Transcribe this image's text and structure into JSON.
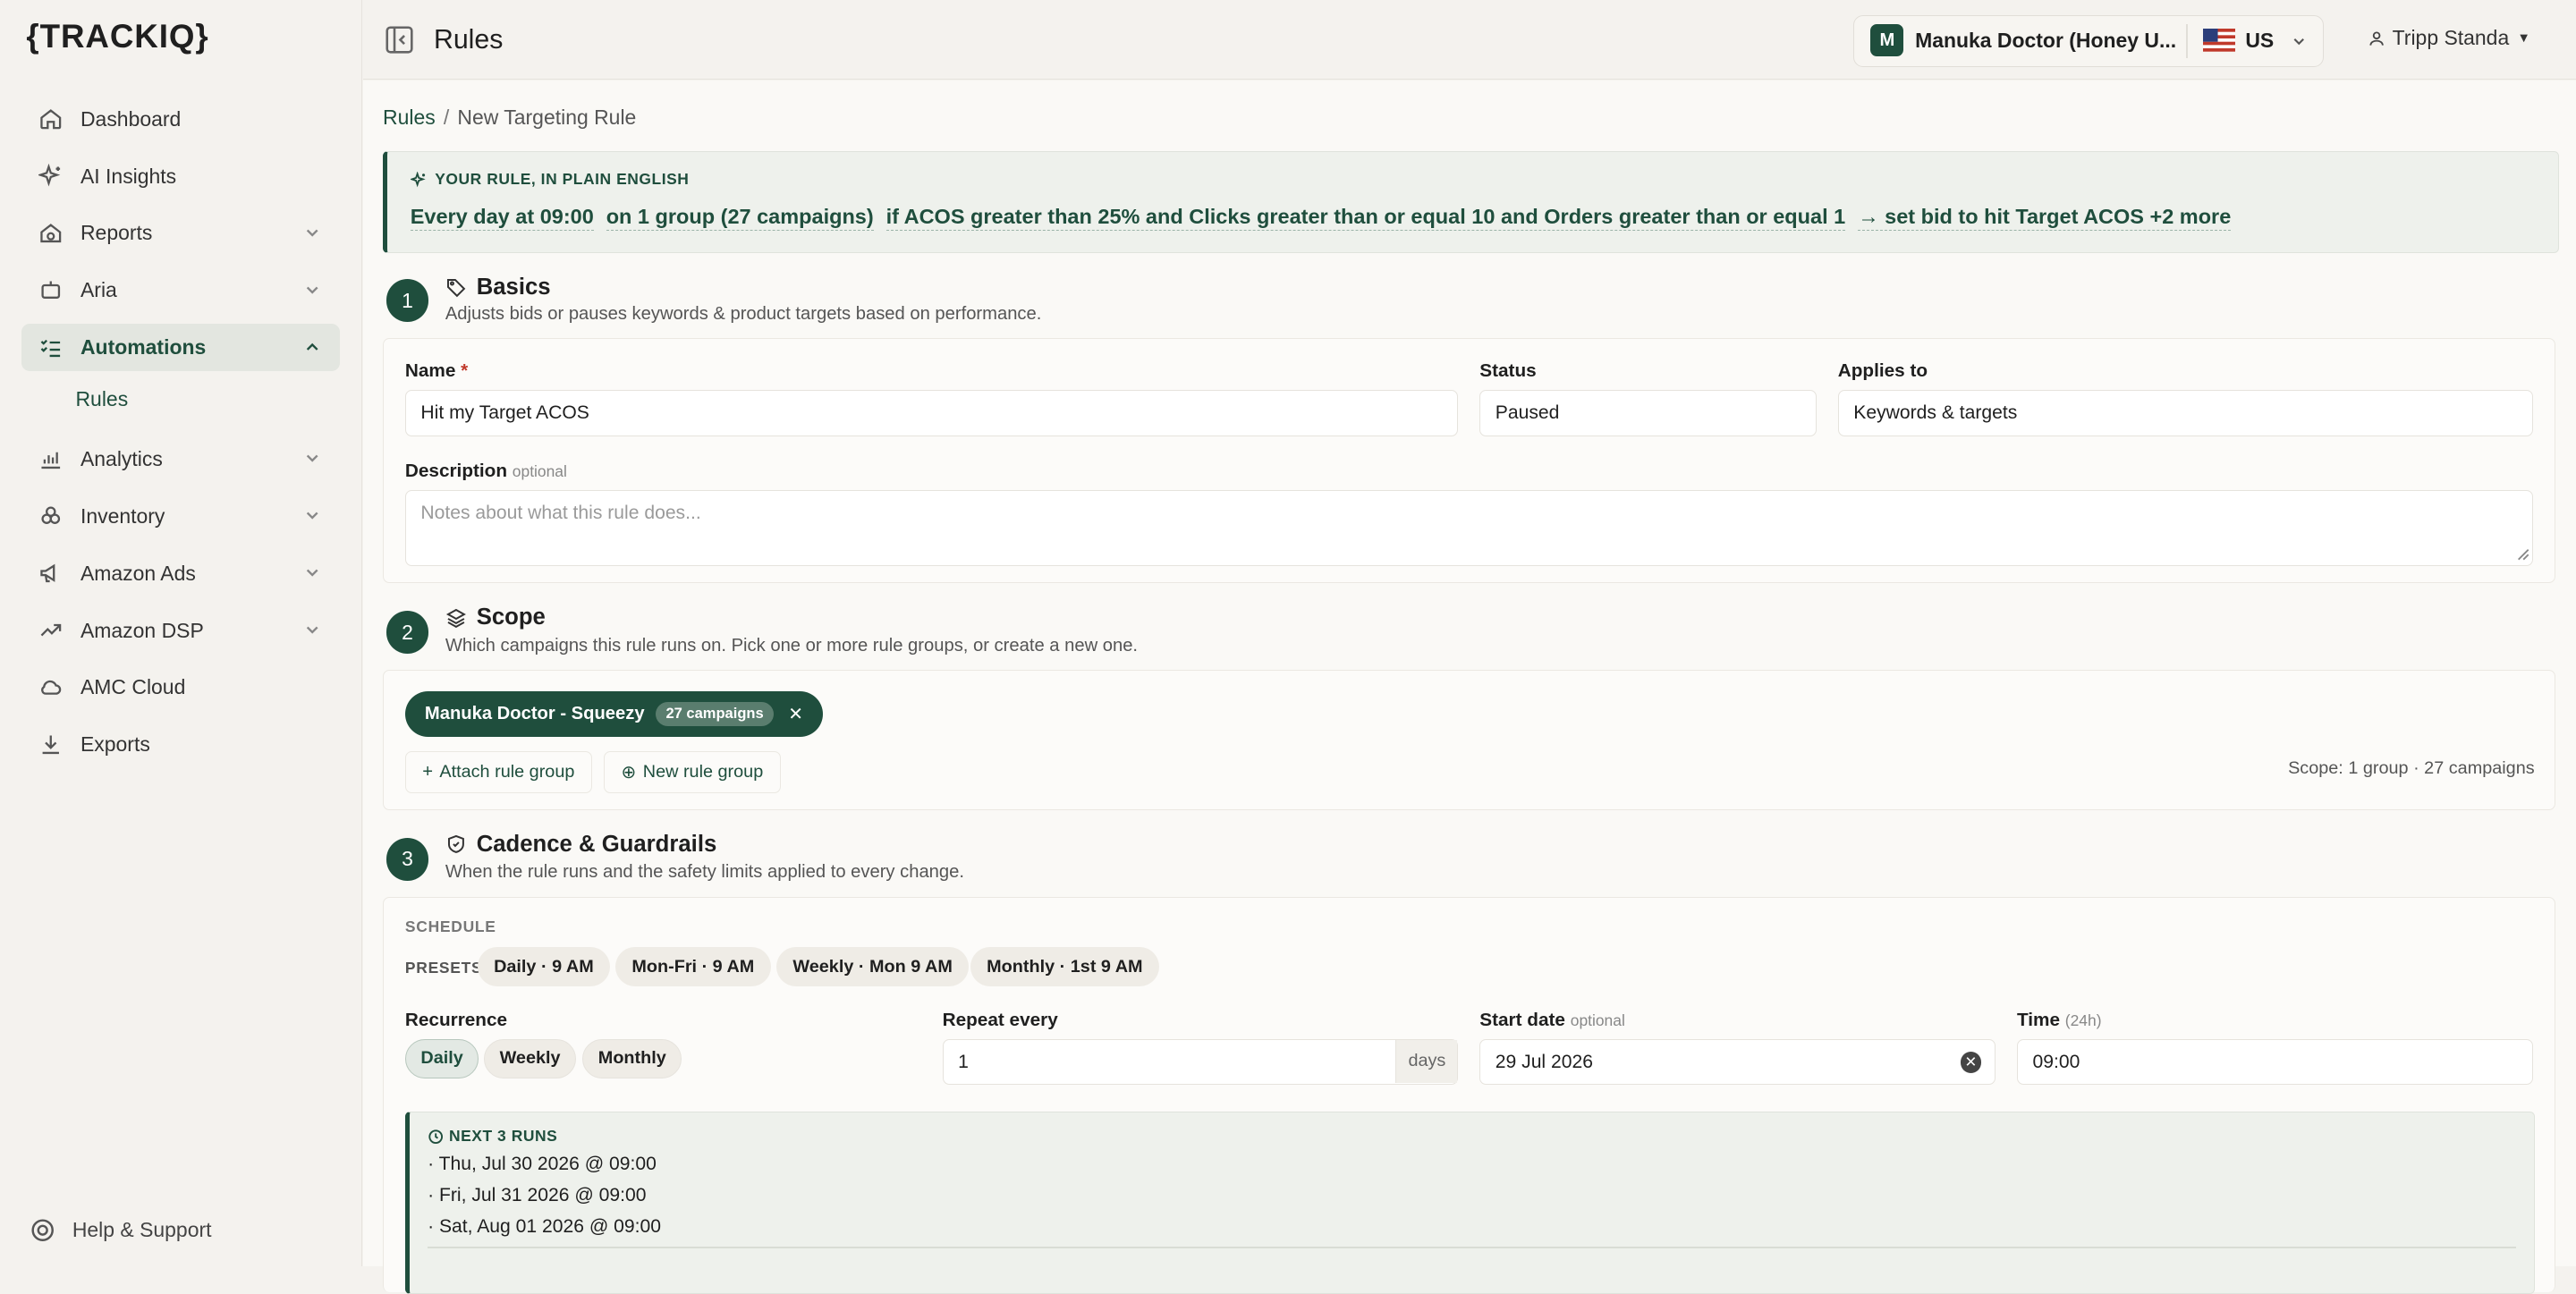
{
  "brand": {
    "logo_text": "{TRACKIQ}",
    "accent": "#1f4e3d"
  },
  "sidebar": {
    "items": [
      {
        "label": "Dashboard",
        "icon": "home-icon"
      },
      {
        "label": "AI Insights",
        "icon": "sparkles-icon"
      },
      {
        "label": "Reports",
        "icon": "reports-icon"
      },
      {
        "label": "Aria",
        "icon": "aria-icon"
      },
      {
        "label": "Automations",
        "icon": "list-checks-icon"
      },
      {
        "label": "Analytics",
        "icon": "bar-chart-icon"
      },
      {
        "label": "Inventory",
        "icon": "boxes-icon"
      },
      {
        "label": "Amazon Ads",
        "icon": "megaphone-icon"
      },
      {
        "label": "Amazon DSP",
        "icon": "trending-up-icon"
      },
      {
        "label": "AMC Cloud",
        "icon": "cloud-icon"
      },
      {
        "label": "Exports",
        "icon": "download-icon"
      }
    ],
    "sub_rules": "Rules",
    "help": "Help & Support"
  },
  "header": {
    "title": "Rules",
    "account_initial": "M",
    "account_name": "Manuka Doctor (Honey U...",
    "marketplace": "US",
    "user": "Tripp Standa"
  },
  "breadcrumb": {
    "parent": "Rules",
    "current": "New Targeting Rule"
  },
  "plain_english": {
    "label": "YOUR RULE, IN PLAIN ENGLISH",
    "schedule": "Every day at 09:00",
    "scope": "on 1 group (27 campaigns)",
    "condition": "if ACOS greater than 25% and Clicks greater than or equal 10 and Orders greater than or equal 1",
    "action": "→ set bid to hit Target ACOS +2 more"
  },
  "basics": {
    "step": "1",
    "title": "Basics",
    "desc": "Adjusts bids or pauses keywords & product targets based on performance.",
    "name_label": "Name",
    "name_req": "*",
    "name_value": "Hit my Target ACOS",
    "status_label": "Status",
    "status_value": "Paused",
    "applies_label": "Applies to",
    "applies_value": "Keywords & targets",
    "desc_label": "Description",
    "desc_optional": "optional",
    "desc_placeholder": "Notes about what this rule does..."
  },
  "scope": {
    "step": "2",
    "title": "Scope",
    "desc": "Which campaigns this rule runs on. Pick one or more rule groups, or create a new one.",
    "group_name": "Manuka Doctor - Squeezy",
    "group_count": "27 campaigns",
    "attach": "Attach rule group",
    "new_group": "New rule group",
    "summary": "Scope: 1 group · 27 campaigns"
  },
  "cadence": {
    "step": "3",
    "title": "Cadence & Guardrails",
    "desc": "When the rule runs and the safety limits applied to every change.",
    "schedule_label": "SCHEDULE",
    "presets_label": "PRESETS:",
    "presets": [
      "Daily · 9 AM",
      "Mon-Fri · 9 AM",
      "Weekly · Mon 9 AM",
      "Monthly · 1st 9 AM"
    ],
    "recurrence_label": "Recurrence",
    "recurrence": [
      "Daily",
      "Weekly",
      "Monthly"
    ],
    "repeat_label": "Repeat every",
    "repeat_value": "1",
    "repeat_unit": "days",
    "start_label": "Start date",
    "start_optional": "optional",
    "start_value": "29 Jul 2026",
    "time_label": "Time",
    "time_hint": "(24h)",
    "time_value": "09:00",
    "next_runs_title": "NEXT 3 RUNS",
    "next_runs": [
      "· Thu, Jul 30 2026 @ 09:00",
      "· Fri, Jul 31 2026 @ 09:00",
      "· Sat, Aug 01 2026 @ 09:00"
    ]
  }
}
